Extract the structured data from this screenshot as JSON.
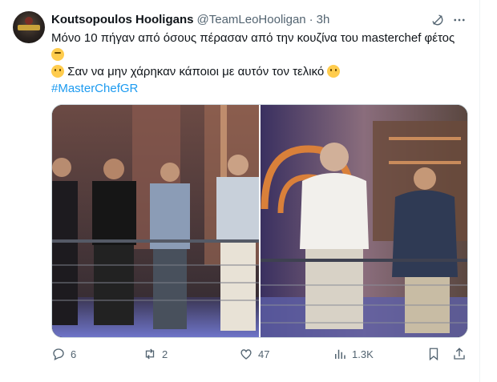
{
  "author": {
    "name": "Koutsopoulos Hooligans",
    "handle": "@TeamLeoHooligan",
    "separator": "·",
    "time": "3h"
  },
  "tweet": {
    "line1": "Μόνο 10 πήγαν από όσους πέρασαν από την κουζίνα του masterchef φέτος",
    "line2": "Σαν να μην χάρηκαν κάποιοι με αυτόν τον τελικό",
    "hashtag": "#MasterChefGR"
  },
  "icons": {
    "reply": "reply-icon",
    "retweet": "retweet-icon",
    "like": "like-icon",
    "views": "views-icon",
    "bookmark": "bookmark-icon",
    "share": "share-icon",
    "grok": "grok-icon",
    "more": "more-icon",
    "emoji_thinking": "thinking-face-emoji",
    "emoji_blank": "face-without-mouth-emoji"
  },
  "stats": {
    "replies": "6",
    "retweets": "2",
    "likes": "47",
    "views": "1.3K"
  },
  "colors": {
    "link": "#1d9bf0",
    "muted": "#536471",
    "text": "#0f1419"
  }
}
